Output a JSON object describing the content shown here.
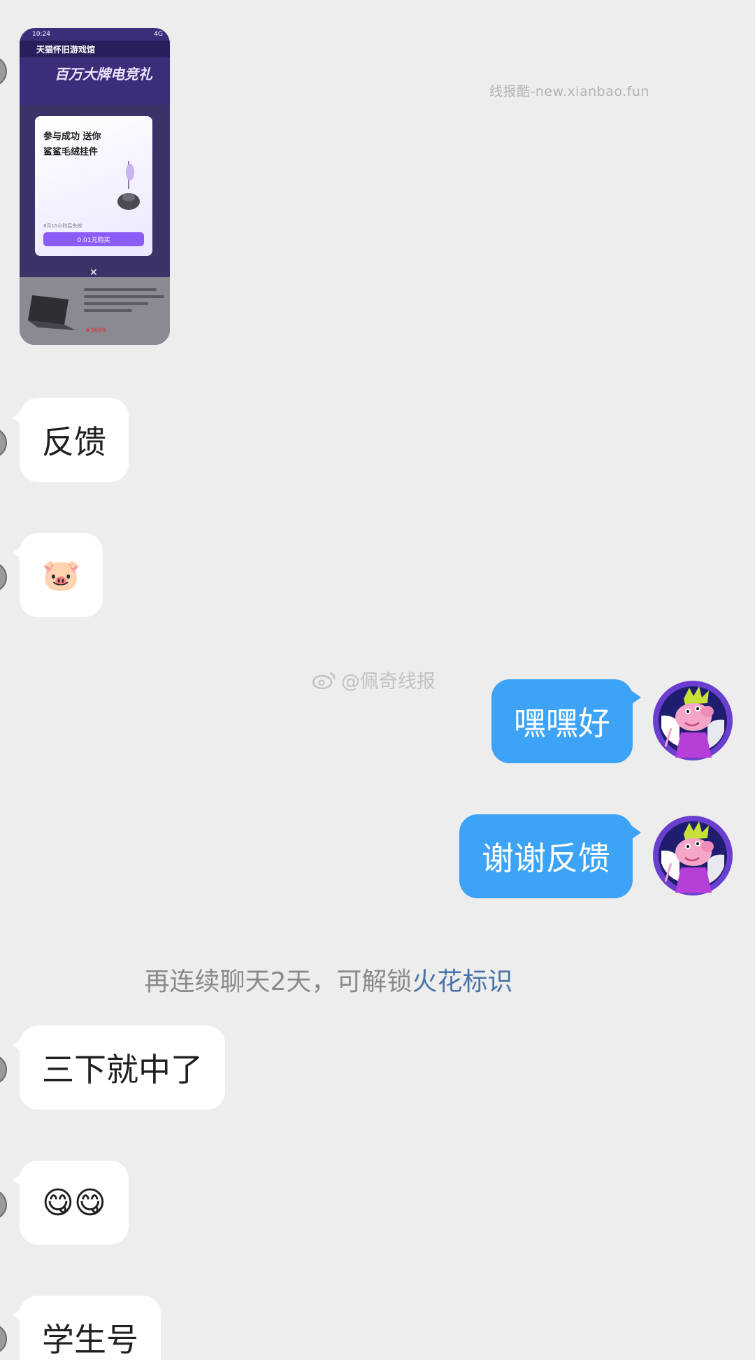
{
  "watermark_top": "线报酷-new.xianbao.fun",
  "watermark_mid": "@佩奇线报",
  "screenshot": {
    "status_time": "10:24",
    "status_right": "4G",
    "nav_title": "天猫怀旧游戏馆",
    "banner": "百万大牌电竞礼",
    "modal_line1": "参与成功 送你",
    "modal_line2": "鲨鲨毛绒挂件",
    "modal_note": "8月15小时后失效",
    "modal_button": "0.01元购买",
    "price": "¥3699"
  },
  "messages": [
    {
      "side": "left",
      "text": "反馈"
    },
    {
      "side": "left",
      "text": "🐷"
    },
    {
      "side": "right",
      "text": "嘿嘿好"
    },
    {
      "side": "right",
      "text": "谢谢反馈"
    },
    {
      "side": "left",
      "text": "三下就中了"
    },
    {
      "side": "left",
      "text": "😋😋"
    },
    {
      "side": "left",
      "text": "学生号"
    }
  ],
  "system_notice": {
    "prefix": "再连续聊天2天，可解锁",
    "highlight": "火花标识"
  },
  "colors": {
    "background": "#ededed",
    "bubble_left": "#ffffff",
    "bubble_right": "#3ca3f6",
    "highlight": "#4a74a8"
  }
}
